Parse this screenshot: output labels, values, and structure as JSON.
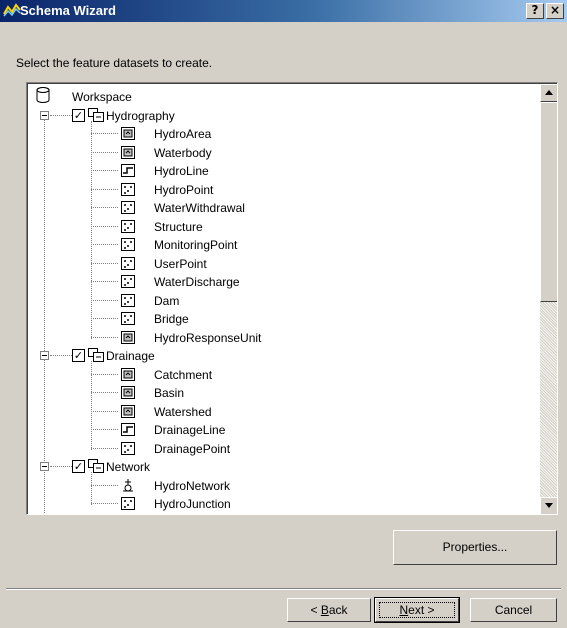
{
  "window": {
    "title": "Schema Wizard",
    "help_glyph": "?",
    "close_glyph": "×"
  },
  "instruction": "Select the feature datasets to create.",
  "tree": {
    "root": {
      "label": "Workspace",
      "icon": "database-icon"
    },
    "groups": [
      {
        "label": "Hydrography",
        "checked": true,
        "expanded": true,
        "items": [
          {
            "label": "HydroArea",
            "type": "polygon"
          },
          {
            "label": "Waterbody",
            "type": "polygon"
          },
          {
            "label": "HydroLine",
            "type": "line"
          },
          {
            "label": "HydroPoint",
            "type": "point"
          },
          {
            "label": "WaterWithdrawal",
            "type": "point"
          },
          {
            "label": "Structure",
            "type": "point"
          },
          {
            "label": "MonitoringPoint",
            "type": "point"
          },
          {
            "label": "UserPoint",
            "type": "point"
          },
          {
            "label": "WaterDischarge",
            "type": "point"
          },
          {
            "label": "Dam",
            "type": "point"
          },
          {
            "label": "Bridge",
            "type": "point"
          },
          {
            "label": "HydroResponseUnit",
            "type": "polygon"
          }
        ]
      },
      {
        "label": "Drainage",
        "checked": true,
        "expanded": true,
        "items": [
          {
            "label": "Catchment",
            "type": "polygon"
          },
          {
            "label": "Basin",
            "type": "polygon"
          },
          {
            "label": "Watershed",
            "type": "polygon"
          },
          {
            "label": "DrainageLine",
            "type": "line"
          },
          {
            "label": "DrainagePoint",
            "type": "point"
          }
        ]
      },
      {
        "label": "Network",
        "checked": true,
        "expanded": true,
        "items": [
          {
            "label": "HydroNetwork",
            "type": "network"
          },
          {
            "label": "HydroJunction",
            "type": "point"
          }
        ]
      }
    ]
  },
  "buttons": {
    "properties": "Properties...",
    "back": {
      "prefix": "< ",
      "mnemonic": "B",
      "rest": "ack"
    },
    "next": {
      "mnemonic": "N",
      "rest": "ext >"
    },
    "cancel": "Cancel"
  },
  "colors": {
    "title_gradient_start": "#0a246a",
    "title_gradient_end": "#a6caf0",
    "dialog_face": "#d4d0c8"
  }
}
